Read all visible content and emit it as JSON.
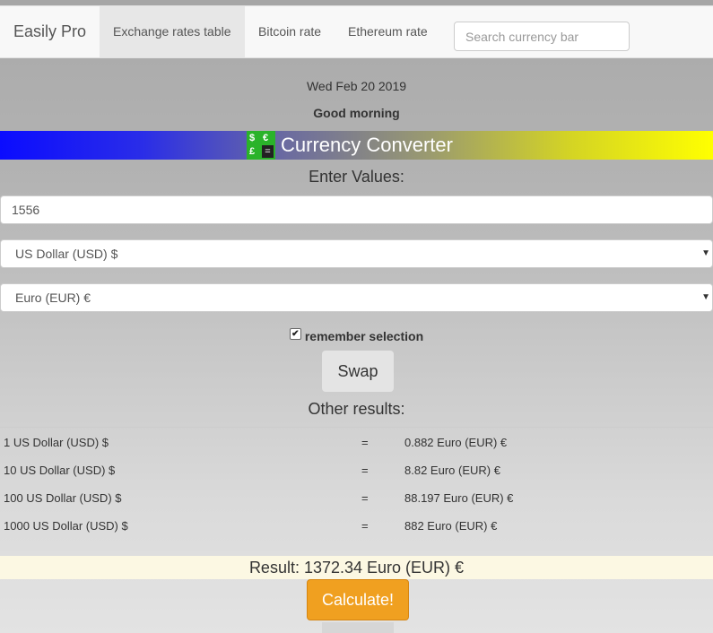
{
  "navbar": {
    "brand": "Easily Pro",
    "items": [
      {
        "label": "Exchange rates table",
        "active": true
      },
      {
        "label": "Bitcoin rate",
        "active": false
      },
      {
        "label": "Ethereum rate",
        "active": false
      }
    ],
    "search_placeholder": "Search currency bar"
  },
  "header": {
    "date": "Wed Feb 20 2019",
    "greeting": "Good morning"
  },
  "banner": {
    "logo_symbols": [
      "$",
      "€",
      "£",
      "="
    ],
    "title": "Currency Converter"
  },
  "form": {
    "enter_label": "Enter Values:",
    "amount_value": "1556",
    "from_currency": "US Dollar (USD) $",
    "to_currency": "Euro (EUR) €",
    "caret": "▼",
    "remember_label": "remember selection",
    "remember_checked": true,
    "checkmark": "✔",
    "swap_label": "Swap"
  },
  "other_results": {
    "heading": "Other results:",
    "rows": [
      {
        "from": "1 US Dollar (USD) $",
        "eq": "=",
        "to": "0.882 Euro (EUR) €"
      },
      {
        "from": "10 US Dollar (USD) $",
        "eq": "=",
        "to": "8.82 Euro (EUR) €"
      },
      {
        "from": "100 US Dollar (USD) $",
        "eq": "=",
        "to": "88.197 Euro (EUR) €"
      },
      {
        "from": "1000 US Dollar (USD) $",
        "eq": "=",
        "to": "882 Euro (EUR) €"
      }
    ]
  },
  "result": {
    "text": "Result: 1372.34 Euro (EUR) €"
  },
  "calculate_label": "Calculate!",
  "colors": {
    "accent_button": "#f0a020",
    "result_bg": "#fcf8e3",
    "banner_start": "#0b0cff",
    "banner_end": "#ffff00",
    "logo_green": "#2ab32a"
  }
}
